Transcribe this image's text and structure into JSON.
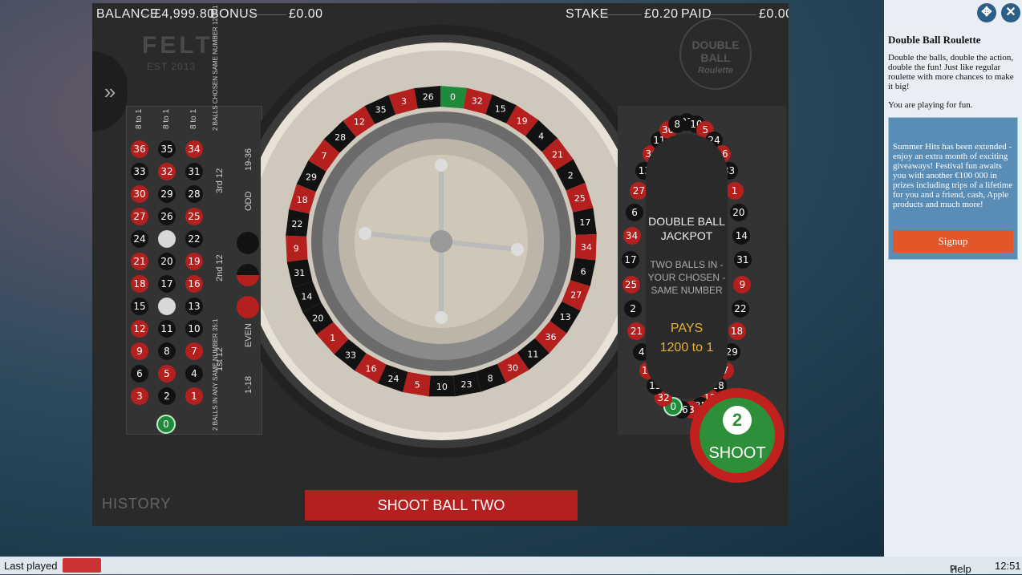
{
  "top": {
    "balance_label": "BALANCE",
    "balance_value": "£4,999.80",
    "bonus_label": "BONUS",
    "bonus_value": "£0.00",
    "stake_label": "STAKE",
    "stake_value": "£0.20",
    "paid_label": "PAID",
    "paid_value": "£0.00"
  },
  "logos": {
    "felt": "FELT",
    "felt_est": "EST 2013",
    "double_ball": "DOUBLE BALL",
    "roulette": "Roulette"
  },
  "table": {
    "col_headers": [
      "8 to 1",
      "8 to 1",
      "8 to 1"
    ],
    "header_note": "2 BALLS CHOSEN SAME NUMBER 1200:1",
    "rows": [
      [
        "36",
        "35",
        "34"
      ],
      [
        "33",
        "32",
        "31"
      ],
      [
        "30",
        "29",
        "28"
      ],
      [
        "27",
        "26",
        "25"
      ],
      [
        "24",
        "",
        "22"
      ],
      [
        "21",
        "20",
        "19"
      ],
      [
        "18",
        "17",
        "16"
      ],
      [
        "15",
        "",
        "13"
      ],
      [
        "12",
        "11",
        "10"
      ],
      [
        "9",
        "8",
        "7"
      ],
      [
        "6",
        "5",
        "4"
      ],
      [
        "3",
        "2",
        "1"
      ]
    ],
    "red_numbers": [
      "36",
      "34",
      "32",
      "30",
      "27",
      "25",
      "21",
      "19",
      "18",
      "16",
      "12",
      "9",
      "7",
      "5",
      "3",
      "1"
    ],
    "zero": "0",
    "dozens": [
      "3rd 12",
      "2nd 12",
      "1st 12"
    ],
    "outside": [
      "19-36",
      "ODD",
      "EVEN",
      "1-18"
    ],
    "bottom_note": "2 BALLS IN ANY SAME NUMBER 35:1"
  },
  "wheel": {
    "numbers": [
      "0",
      "32",
      "15",
      "19",
      "4",
      "21",
      "2",
      "25",
      "17",
      "34",
      "6",
      "27",
      "13",
      "36",
      "11",
      "30",
      "8",
      "23",
      "10",
      "5",
      "24",
      "16",
      "33",
      "1",
      "20",
      "14",
      "31",
      "9",
      "22",
      "18",
      "29",
      "7",
      "28",
      "12",
      "35",
      "3",
      "26"
    ]
  },
  "jackpot": {
    "title": "DOUBLE BALL JACKPOT",
    "sub": "TWO BALLS IN - YOUR CHOSEN - SAME NUMBER",
    "pays": "PAYS",
    "odds": "1200 to 1",
    "track_numbers": [
      "23",
      "10",
      "5",
      "24",
      "16",
      "33",
      "1",
      "20",
      "14",
      "31",
      "9",
      "22",
      "18",
      "29",
      "7",
      "28",
      "12",
      "35",
      "3",
      "26",
      "0",
      "32",
      "15",
      "19",
      "4",
      "21",
      "2",
      "25",
      "17",
      "34",
      "6",
      "27",
      "13",
      "36",
      "11",
      "30",
      "8"
    ]
  },
  "shoot": {
    "count": "2",
    "label": "SHOOT"
  },
  "history_label": "HISTORY",
  "shoot_ball_label": "SHOOT BALL TWO",
  "panel": {
    "title": "Double Ball Roulette",
    "description": "Double the balls, double the action, double the fun! Just like regular roulette with more chances to make it big!",
    "fun_note": "You are playing for fun.",
    "promo": "Summer Hits has been extended - enjoy an extra month of exciting giveaways! Festival fun awaits you with another €100 000 in prizes including trips of a lifetime for you and a friend, cash, Apple products and much more!",
    "signup": "Signup"
  },
  "bottom": {
    "last_played": "Last played",
    "help": "Help",
    "time": "12:51"
  },
  "colors": {
    "red": "#b3201e",
    "black": "#121212",
    "green": "#1f8a3a",
    "gold": "#e3b23c",
    "signup": "#e2562a"
  }
}
